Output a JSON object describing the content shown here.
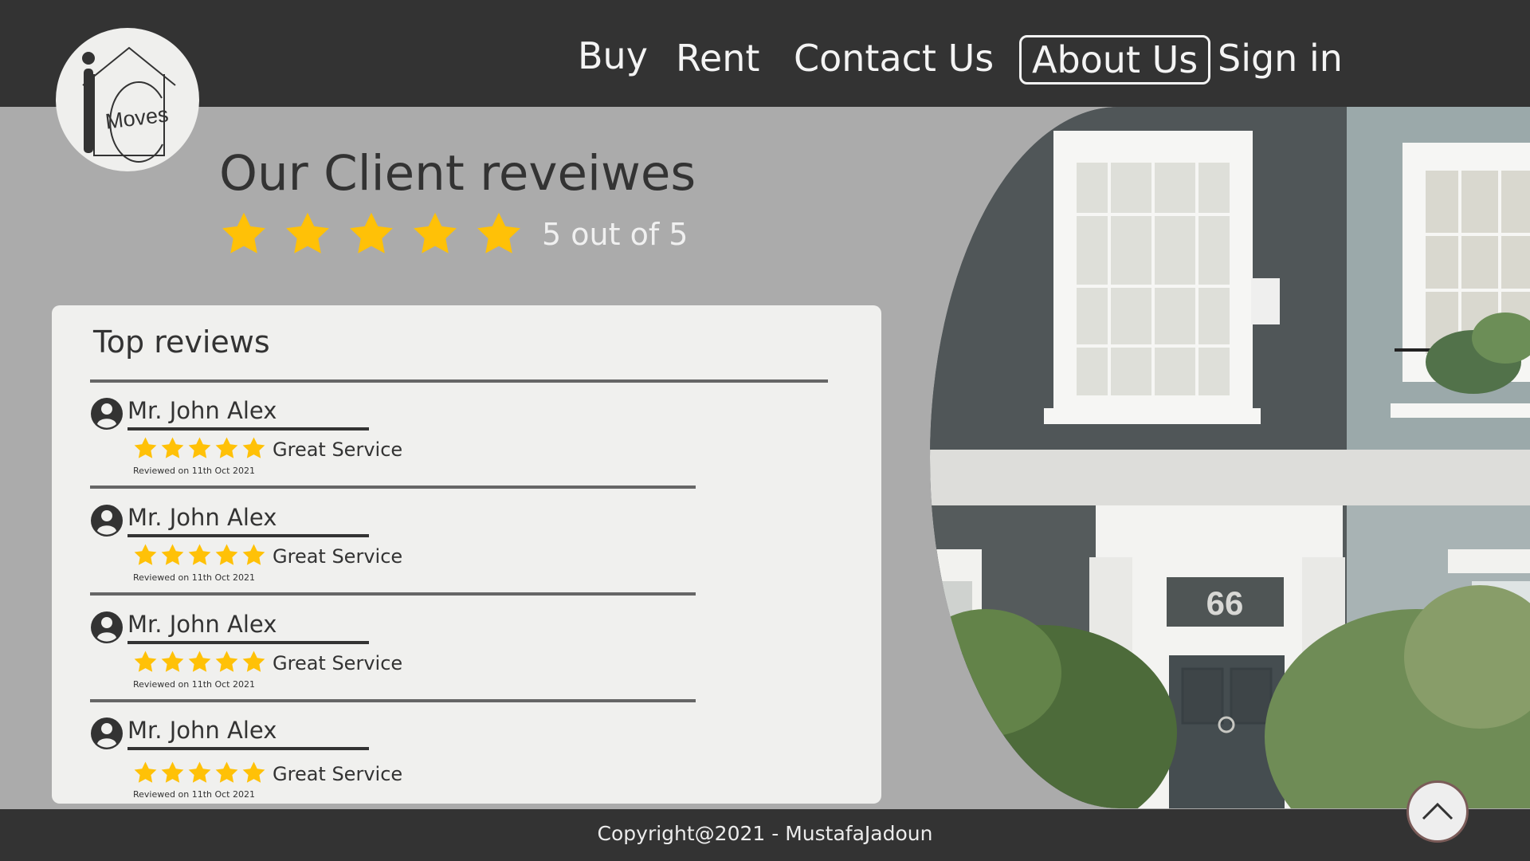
{
  "header": {
    "logo_text": "Moves",
    "nav": [
      {
        "label": "Buy"
      },
      {
        "label": "Rent"
      },
      {
        "label": "Contact Us"
      },
      {
        "label": "About Us"
      },
      {
        "label": "Sign in"
      }
    ]
  },
  "hero": {
    "title": "Our Client reveiwes",
    "rating_stars": 5,
    "rating_text": "5 out of 5"
  },
  "reviews_card": {
    "title": "Top reviews",
    "reviews": [
      {
        "name": "Mr. John Alex",
        "stars": 5,
        "text": "Great Service",
        "date": "Reviewed on 11th Oct 2021"
      },
      {
        "name": "Mr. John Alex",
        "stars": 5,
        "text": "Great Service",
        "date": "Reviewed on 11th Oct 2021"
      },
      {
        "name": "Mr. John Alex",
        "stars": 5,
        "text": "Great Service",
        "date": "Reviewed on 11th Oct 2021"
      },
      {
        "name": "Mr. John Alex",
        "stars": 5,
        "text": "Great Service",
        "date": "Reviewed on 11th Oct 2021"
      }
    ]
  },
  "house_number": "66",
  "footer": {
    "copyright": "Copyright@2021 - MustafaJadoun"
  },
  "icons": [
    "star-icon",
    "user-avatar-icon",
    "chevron-up-icon",
    "house-logo-icon"
  ],
  "colors": {
    "header": "#333333",
    "background": "#ababab",
    "card": "#f0f0ee",
    "star": "#ffc107",
    "text": "#333333"
  }
}
